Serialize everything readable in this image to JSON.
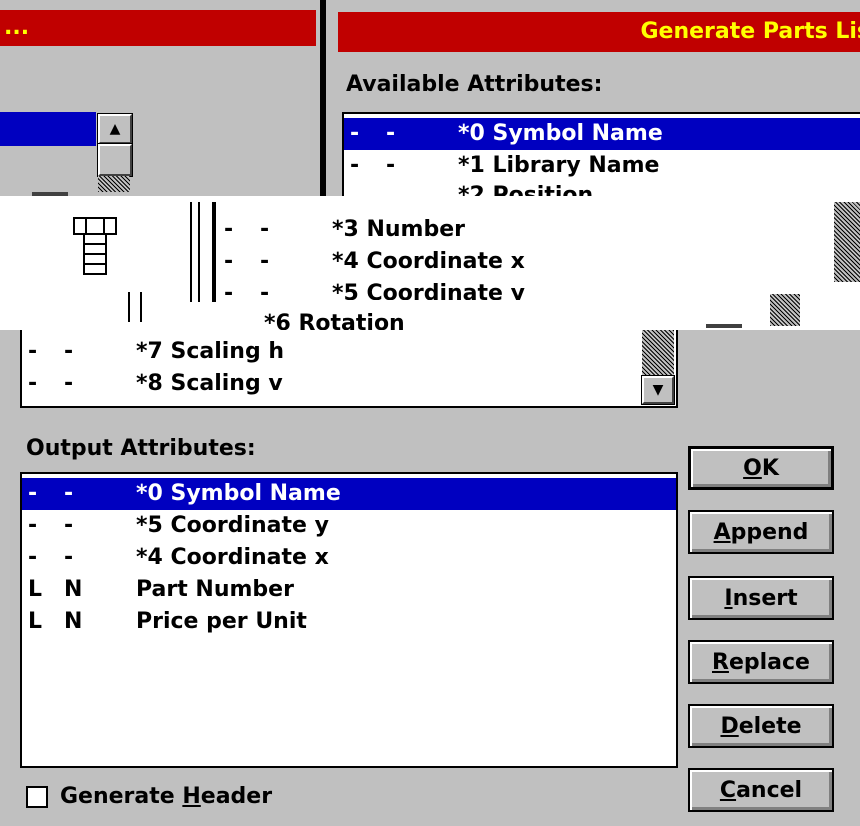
{
  "left_window": {
    "title_fragment": "..."
  },
  "dialog": {
    "title": "Generate Parts Lis",
    "available_label": "Available Attributes:",
    "output_label": "Output Attributes:",
    "available_top": [
      {
        "c1": "-",
        "c2": "-",
        "c3": "*0 Symbol Name",
        "selected": true
      },
      {
        "c1": "-",
        "c2": "-",
        "c3": "*1 Library Name",
        "selected": false
      },
      {
        "c1": "",
        "c2": "",
        "c3": "*2 Position",
        "selected": false
      }
    ],
    "available_glitch": [
      {
        "c1": "-",
        "c2": "-",
        "c3": "*3 Number"
      },
      {
        "c1": "-",
        "c2": "-",
        "c3": "*4 Coordinate x"
      },
      {
        "c1": "-",
        "c2": "-",
        "c3": "*5 Coordinate y"
      },
      {
        "c1": "",
        "c2": "",
        "c3": "*6 Rotation"
      }
    ],
    "available_bottom": [
      {
        "c1": "-",
        "c2": "-",
        "c3": "*7 Scaling h"
      },
      {
        "c1": "-",
        "c2": "-",
        "c3": "*8 Scaling v"
      }
    ],
    "output": [
      {
        "c1": "-",
        "c2": "-",
        "c3": "*0 Symbol Name",
        "selected": true
      },
      {
        "c1": "-",
        "c2": "-",
        "c3": "*5 Coordinate y",
        "selected": false
      },
      {
        "c1": "-",
        "c2": "-",
        "c3": "*4 Coordinate x",
        "selected": false
      },
      {
        "c1": "L",
        "c2": "N",
        "c3": "Part Number",
        "selected": false
      },
      {
        "c1": "L",
        "c2": "N",
        "c3": "Price per Unit",
        "selected": false
      }
    ],
    "buttons": {
      "ok": {
        "pre": "",
        "u": "O",
        "post": "K"
      },
      "append": {
        "pre": "",
        "u": "A",
        "post": "ppend"
      },
      "insert": {
        "pre": "",
        "u": "I",
        "post": "nsert"
      },
      "replace": {
        "pre": "",
        "u": "R",
        "post": "eplace"
      },
      "delete": {
        "pre": "",
        "u": "D",
        "post": "elete"
      },
      "cancel": {
        "pre": "",
        "u": "C",
        "post": "ancel"
      }
    },
    "generate_header": {
      "pre": "Generate ",
      "u": "H",
      "post": "eader",
      "checked": false
    }
  },
  "colors": {
    "titlebar": "#c00000",
    "title_text": "#ffff00",
    "selection": "#0000c0",
    "face": "#c0c0c0"
  },
  "icons": [
    "scroll-up-arrow-icon",
    "scroll-down-arrow-icon",
    "bolt-icon"
  ]
}
